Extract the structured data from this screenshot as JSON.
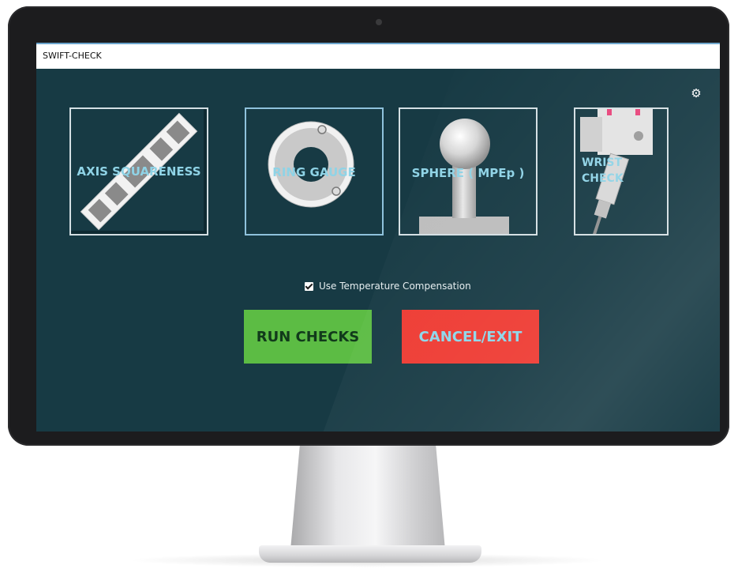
{
  "window": {
    "title": "SWIFT-CHECK"
  },
  "tiles": [
    {
      "label": "AXIS SQUARENESS"
    },
    {
      "label": "RING GAUGE"
    },
    {
      "label": "SPHERE ( MPEp )"
    },
    {
      "label_line1": "WRIST",
      "label_line2": "CHECK"
    }
  ],
  "options": {
    "temperature_compensation_label": "Use Temperature Compensation",
    "temperature_compensation_checked": true
  },
  "buttons": {
    "run_label": "RUN CHECKS",
    "cancel_label": "CANCEL/EXIT"
  },
  "colors": {
    "screen_bg": "#173a44",
    "tile_label": "#8fd3e6",
    "run_button": "#5cbc44",
    "cancel_button": "#ee3a32"
  },
  "icons": {
    "settings": "gear-icon"
  }
}
